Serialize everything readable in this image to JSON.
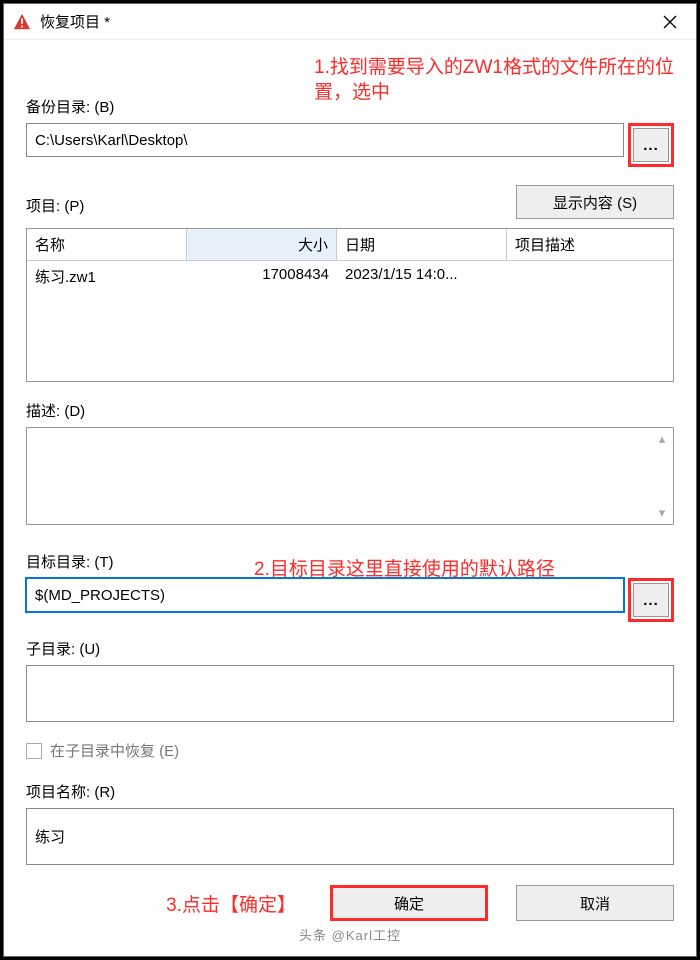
{
  "window": {
    "title": "恢复项目 *"
  },
  "annotations": {
    "a1": "1.找到需要导入的ZW1格式的文件所在的位置，选中",
    "a2": "2.目标目录这里直接使用的默认路径",
    "a3": "3.点击【确定】"
  },
  "labels": {
    "backup_dir": "备份目录: (B)",
    "project": "项目: (P)",
    "desc": "描述: (D)",
    "target_dir": "目标目录: (T)",
    "sub_dir": "子目录: (U)",
    "restore_in_subdir": "在子目录中恢复 (E)",
    "project_name": "项目名称: (R)"
  },
  "values": {
    "backup_dir": "C:\\Users\\Karl\\Desktop\\",
    "target_dir": "$(MD_PROJECTS)",
    "sub_dir": "",
    "project_name": "练习"
  },
  "table": {
    "headers": {
      "name": "名称",
      "size": "大小",
      "date": "日期",
      "desc": "项目描述"
    },
    "rows": [
      {
        "name": "练习.zw1",
        "size": "17008434",
        "date": "2023/1/15 14:0...",
        "desc": ""
      }
    ]
  },
  "buttons": {
    "browse": "...",
    "show_content": "显示内容 (S)",
    "ok": "确定",
    "cancel": "取消"
  },
  "footer": "头条 @Karl工控"
}
